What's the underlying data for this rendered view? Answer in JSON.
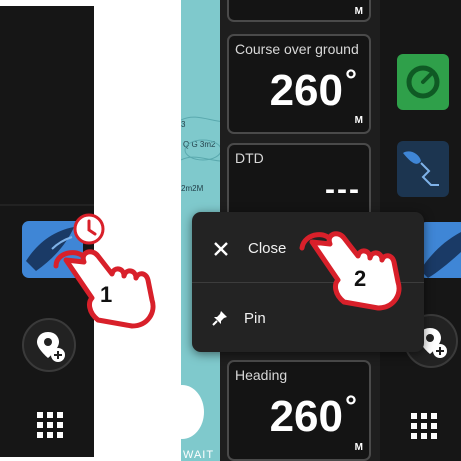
{
  "left_panel": {
    "waypoint_icon": "add-waypoint-icon",
    "menu_icon": "grid-menu-icon",
    "app_tile_icon": "boat-app-icon",
    "badge_icon": "clock-badge-icon"
  },
  "map": {
    "labels": [
      "3",
      "Q G 3m2",
      "2m2M"
    ],
    "status": "WAIT"
  },
  "cards": [
    {
      "unit": "M"
    },
    {
      "title": "Course over ground",
      "value": "260",
      "degree": "°",
      "unit": "M"
    },
    {
      "title": "DTD",
      "value": "---"
    },
    {
      "title": "Heading",
      "value": "260",
      "degree": "°",
      "unit": "M"
    }
  ],
  "popup_menu": {
    "items": [
      {
        "label": "Close",
        "icon": "close-icon"
      },
      {
        "label": "Pin",
        "icon": "pin-icon"
      }
    ]
  },
  "callouts": {
    "step1": "1",
    "step2": "2"
  },
  "colors": {
    "panel_bg": "#161616",
    "card_bg": "#141414",
    "accent_blue": "#3f86d6",
    "accent_green": "#2fa04a",
    "callout_red": "#d8202a"
  }
}
